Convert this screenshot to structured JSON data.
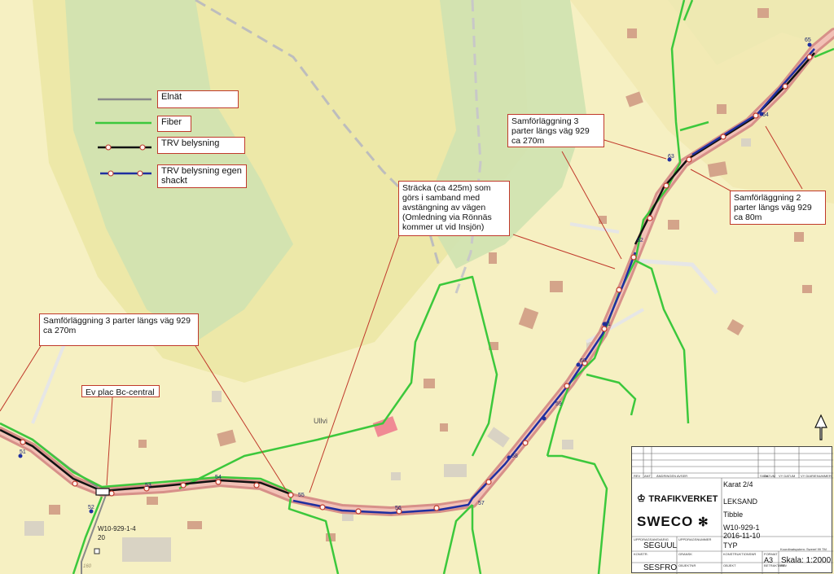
{
  "legend": {
    "items": [
      {
        "label": "Elnät",
        "color": "#8a8a8a",
        "style": "gray"
      },
      {
        "label": "Fiber",
        "color": "#3cc83c",
        "style": "green"
      },
      {
        "label": "TRV belysning",
        "color": "#111111",
        "style": "black-dots"
      },
      {
        "label": "TRV belysning egen\nshackt",
        "color": "#1f2fa0",
        "style": "blue-dots"
      }
    ]
  },
  "callouts": {
    "samf3_right": "Samförläggning 3\nparter längs väg 929\nca 270m",
    "samf2_right": "Samförläggning 2\nparter längs väg 929\nca 80m",
    "stracka": "Sträcka (ca 425m) som\ngörs i samband med\navstängning av vägen\n(Omledning via Rönnäs\nkommer ut vid Insjön)",
    "samf3_left": "Samförläggning 3 parter längs väg 929\nca 270m",
    "bc_central": "Ev plac Bc-central"
  },
  "map_labels": {
    "place": "Ullvi",
    "cabinet": "W10-929-1-4",
    "cabinet_no": "20",
    "pole_numbers": [
      "51",
      "52",
      "53",
      "54",
      "55",
      "56",
      "57",
      "58",
      "59",
      "60",
      "61",
      "62",
      "63",
      "64",
      "65"
    ],
    "contour_160": "160"
  },
  "title_block": {
    "header_small": [
      "REV",
      "ANT",
      "ÄNDRINGEN AVSER",
      "SIGN",
      "DATUM",
      "VY DATUM",
      "VY DIARIENUMMER"
    ],
    "org1": "TRAFIKVERKET",
    "org2": "SWECO",
    "line1": "Karat 2/4",
    "line2": "LEKSAND",
    "line3": "Tibble",
    "drawing_no": "W10-929-1",
    "date": "2016-11-10",
    "type": "TYP",
    "sign1": "SEGUUL",
    "sign2": "SESFRO",
    "format": "A3",
    "scale": "Skala: 1:2000",
    "coord": "Koordinatsystem: Sweref 99 TM",
    "small_labels": [
      "UPPDRAGSANSVARIG",
      "UPPDRAGSNUMMER",
      "KONSTR.",
      "GRANSK",
      "KONSTRUKTIONSNR",
      "FORMAT",
      "OBJEKT",
      "BETRAKTARE",
      "OBJEKTNR",
      "REV"
    ]
  },
  "colors": {
    "terrain_light": "#f6f0c2",
    "terrain_field": "#ede8a8",
    "forest": "#cfe2b0",
    "road_casing": "#d79089",
    "fiber": "#3cc83c",
    "elnat": "#8a8a8a",
    "trv": "#111111",
    "trv_own": "#1f2fa0",
    "callout_border": "#c0392b"
  }
}
